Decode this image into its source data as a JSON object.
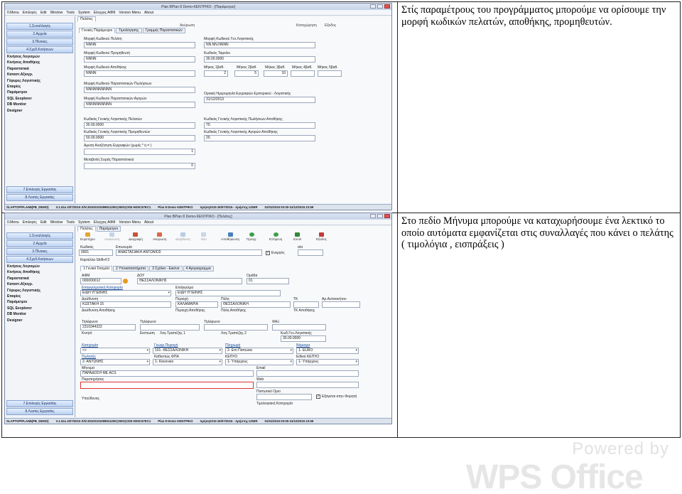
{
  "notes": {
    "top": "Στίς παραμέτρους του προγράμματος μπορούμε να ορίσουμε την μορφή κωδικών πελατών, αποθήκης, προμηθευτών.",
    "bottom": "Στο πεδίο Μήνυμα μπορούμε να καταχωρήσουμε ένα λεκτικό το οποίο αυτόματα εμφανίζεται στις συναλλαγές που κάνει ο πελάτης ( τιμολόγια , εισπράξεις )"
  },
  "menu": [
    "0.Menu",
    "Επιλογές",
    "Edit",
    "Window",
    "Tools",
    "System",
    "Ελεγχος ΑΦΜ",
    "Version Menu",
    "About"
  ],
  "sidebar": {
    "top_buttons": [
      "1.Συναλλαγές",
      "2.Αρχεία",
      "3.Πίνακες",
      "4.Σχεδ.Κινήσεων"
    ],
    "items": [
      "Κινήσεις Λογισμών",
      "Κινήσεις Αποθήκης",
      "Παραστατικά",
      "Καταστ.Αξιογρ.",
      "Γέφυρες Λογιστικής",
      "Εταιρίες",
      "Παράμετροι",
      "SQL Eexplorer",
      "DB Monitor",
      "Designer"
    ],
    "bottom_buttons": [
      "7.Επιλογές Εργασίας",
      "8.Λοιπές Εργασίες"
    ]
  },
  "win1": {
    "title": "Plan BPlan 8 Demo-ΚΕΝΤΡΙΚΟ - [Παράμετροι]",
    "toptab": "Πελάτες",
    "toolbar": [
      "Ακύρωση",
      "Καταχώρηση",
      "Εξοδος"
    ],
    "tabs": [
      "Γενικές Παράμετροι",
      "Τιμολόγησης",
      "Γραμμές Παραστατικών"
    ],
    "labels": {
      "customer_code_format": "Μορφή Κωδικού Πελάτη",
      "supplier_code_format": "Μορφή Κωδικού Προμηθευτή",
      "warehouse_code_format": "Μορφή Κωδικού Αποθήκης",
      "sales_doc_code_format": "Μορφή Κωδικού Παραστατικών Πωλήσεων",
      "purchase_doc_code_format": "Μορφή Κωδικού Παραστατικών Αγορών",
      "gl_code_format": "Μορφή Κωδικού Γεν.Λογιστικής",
      "cash_code": "Κωδικός Ταμείου",
      "len1": "Μήκος 1βαθ.",
      "len2": "Μήκος 2βαθ.",
      "len3": "Μήκος 3βαθ.",
      "len4": "Μήκος 4βαθ.",
      "len5": "Μήκος 5βαθ.",
      "limit_date": "Οριακή Ημερομηνία Εγγραφών Εμπορικού - Λογιστικής",
      "gl_customer": "Κωδικός Γενικής Λογιστικής Πελατών",
      "gl_supplier": "Κωδικός Γενικής Λογιστικής Προμηθευτών",
      "gl_sales": "Κωδικός Γενικής Λογιστικής Πωλήσεων Αποθήκης",
      "gl_purchases": "Κωδικός Γενικής Λογιστικής Αγορών Αποθήκης",
      "instant_search": "Αμεση Αναζήτηση Εγγραφών (χωρίς * ή = )",
      "order_change": "Μεταβολή Σειράς Παραστατικού"
    },
    "values": {
      "customer_code_format": "NNNN",
      "supplier_code_format": "NNNN",
      "warehouse_code_format": "NNNN",
      "sales_doc_code_format": "NNNNNNNNNN",
      "purchase_doc_code_format": "NNNNNNNNNN",
      "gl_code_format": "NN.NN.NNNN",
      "cash_code": "30.00.0000",
      "len1": "2",
      "len2": "5",
      "len3": "10",
      "limit_date": "31/12/2013",
      "gl_customer": "30.00.0000",
      "gl_supplier": "50.00.0000",
      "gl_sales": "70.",
      "gl_purchases": "20.",
      "instant_search": "1",
      "order_change": "0"
    },
    "status": [
      "SLAPTOP\\PLAN8(PB_DEMO)",
      "V.1.02a 20/7/2015 S/N:30100101099911200@500@300 HD0C67EC1",
      "Plan 8 Demo KENTPIKO",
      "Χρήση2015 26/07/2015 - Χρήστης:USER",
      "01/01/2015 00:00-31/12/2015 23:59"
    ]
  },
  "win2": {
    "title": "Plan BPlan 8 Demo-ΚΕΝΤΡΙΚΟ - [Πελάτες]",
    "toptabs": [
      "Πελάτες",
      "Παράμετροι"
    ],
    "toolbar": [
      "Ευρετήριο",
      "Ανανέωση",
      "Διαγραφή",
      "Ακύρωση",
      "Διόρθωση",
      "Νέο",
      "Αποθήκευση",
      "Προηγ.",
      "Επόμενη",
      "Excel",
      "Εξοδος"
    ],
    "labels": {
      "code": "Κωδικός",
      "name": "Επωνυμία",
      "active": "Ενεργός",
      "aa": "α/α",
      "shortcut": "Καρτέλλα Shift+F2",
      "afm": "ΑΦΜ",
      "doy": "ΔΟΥ",
      "group": "Ομάδα",
      "category": "Επαγγελματική Κατηγορία",
      "profession": "Επάγγελμα",
      "address": "Διεύθυνση",
      "area": "Περιοχή",
      "city": "Πόλη",
      "zip": "ΤΚ",
      "plate": "Αρ.Αυτοκινήτου",
      "wh_address": "Διεύθυνση Αποθήκης",
      "wh_area": "Περιοχή Αποθήκης",
      "wh_city": "Πόλη Αποθήκης",
      "wh_zip": "ΤΚ Αποθήκης",
      "phone1": "Τηλέφωνο",
      "phone2": "Τηλέφωνο",
      "phone3": "Τηλέφωνο",
      "fax": "ΦΑΞ",
      "mobile": "Κινητό",
      "discount": "Εκπτωση",
      "account": "Λογ.Τραπέζης 1",
      "account2": "Λογ.Τραπέζης 2",
      "gl_code": "Κωδ.Γεν.Λογιστικής",
      "cat": "Κατηγορία",
      "geo": "Γεωγρ.Περιοχή",
      "payment": "Πληρωμή",
      "currency": "Νόμισμα",
      "seller": "Πωλητής",
      "vat": "Καθεστώς ΦΠΑ",
      "cost_center": "ΚΕΠΥΟ",
      "special": "Ειδικό ΚΕΠΥΟ",
      "message": "Μήνυμα",
      "email": "Email",
      "remarks": "Παρατηρήσεις",
      "web": "Web",
      "credit": "Πιστωτικό Οριο",
      "display": "Εξαγεται στην Φορητή",
      "collection": "Υπεύθυνος",
      "price_cat": "Τιμολογιακή Κατηγορία"
    },
    "tabs": [
      "1 Γενικά Στοιχεία",
      "2 Υποκαταστήματα",
      "3 Σχόλια - Εικόνα",
      "4 Αγοραγραμμα"
    ],
    "values": {
      "code": "0001",
      "name": "ΑΝΑΣΤΑΣΙΑΚΗ ΑΝΤΩΝΙΟΣ",
      "afm": "000000012",
      "doy": "ΘΕΣΣΑΛΟΝΙΚΗΣ",
      "group": "01",
      "category": "ΕΙΔΗ ΥΓΙΕΙΝΗΣ",
      "profession": "ΕΙΔΗ ΥΓΙΕΙΝΗΣ",
      "address": "ΚΩΣΤΑΚΗ 15",
      "area": "ΚΑΛΑΜΑΡΙΑ",
      "city": "ΘΕΣΣΑΛΟΝΙΚΗ",
      "phone1": "2310344222",
      "gl_code": "30.00.0000",
      "cat": "<>",
      "geo": "101- ΘΕΣΣΑΛΟΝΙΚΗ",
      "payment": "2- Επί Πιστώσει",
      "currency": "1- EURO",
      "seller": "2- ΑΝΤΩΝΗΣ",
      "vat": "1- Κανονικό",
      "cost_center": "1- Υπάρχους",
      "special": "1- Υπάρχους",
      "message": "ΠΑΡΑΔΟΣΗ ΜΕ ACS"
    },
    "status": [
      "SLAPTOP\\PLAN8(PB_DEMO)",
      "V.1.02a 20/7/2015 S/N:30100101099911200@500@300 HD0C67EC1",
      "Plan 8 Demo KENTPIKO",
      "Χρήση2015 26/07/2015 - Χρήστης:USER",
      "01/01/2015 00:00-31/12/2015 23:59"
    ]
  },
  "watermark": {
    "line1": "Powered by",
    "line2": "WPS Office"
  }
}
